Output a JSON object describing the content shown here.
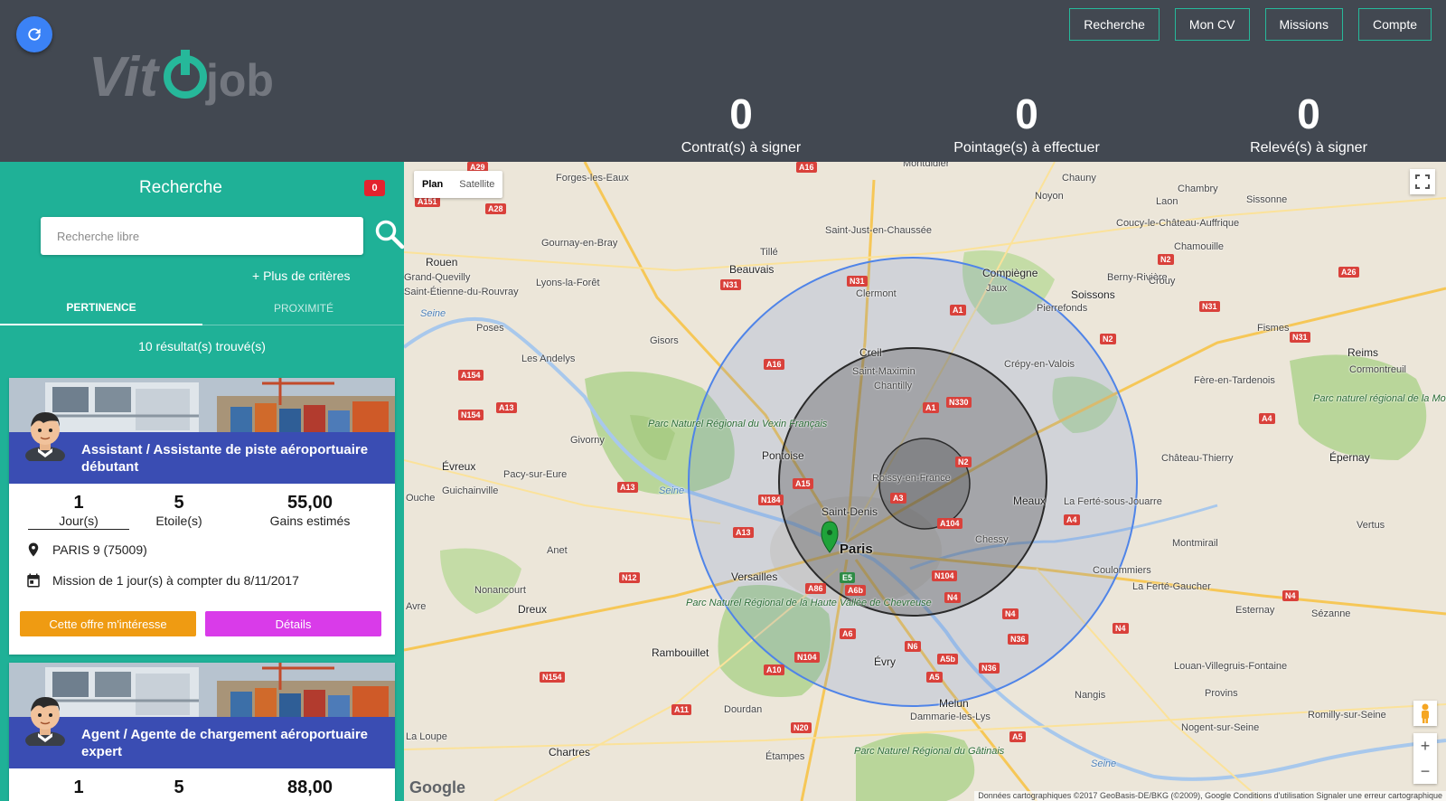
{
  "header": {
    "logo_text": "Vitojob",
    "nav": [
      "Recherche",
      "Mon CV",
      "Missions",
      "Compte"
    ],
    "stats": [
      {
        "value": "0",
        "label": "Contrat(s) à signer"
      },
      {
        "value": "0",
        "label": "Pointage(s) à effectuer"
      },
      {
        "value": "0",
        "label": "Relevé(s) à signer"
      }
    ]
  },
  "sidebar": {
    "title": "Recherche",
    "badge_count": "0",
    "search_placeholder": "Recherche libre",
    "more_criteria": "+ Plus de critères",
    "tabs": [
      "PERTINENCE",
      "PROXIMITÉ"
    ],
    "results_count": "10 résultat(s) trouvé(s)"
  },
  "jobs": [
    {
      "title": "Assistant / Assistante de piste aéroportuaire débutant",
      "days": "1",
      "days_label": "Jour(s)",
      "stars": "5",
      "stars_label": "Etoile(s)",
      "gains": "55,00",
      "gains_label": "Gains estimés",
      "location": "PARIS 9 (75009)",
      "mission": "Mission de 1 jour(s) à compter du 8/11/2017",
      "btn_interest": "Cette offre m'intéresse",
      "btn_details": "Détails"
    },
    {
      "title": "Agent / Agente de chargement aéroportuaire expert",
      "days": "1",
      "stars": "5",
      "gains": "88,00"
    }
  ],
  "map": {
    "type_options": [
      "Plan",
      "Satellite"
    ],
    "active_type": "Plan",
    "fullscreen_icon": "fullscreen-icon",
    "zoom_in": "+",
    "zoom_out": "−",
    "google_logo": "Google",
    "attribution": "Données cartographiques ©2017 GeoBasis-DE/BKG (©2009), Google    Conditions d'utilisation    Signaler une erreur cartographique",
    "cities": {
      "forges": "Forges-les-Eaux",
      "chauny": "Chauny",
      "laon": "Laon",
      "noyon": "Noyon",
      "chambry": "Chambry",
      "sissonne": "Sissonne",
      "montdidier": "Montdidier",
      "saint_just": "Saint-Just-en-Chaussée",
      "coucy": "Coucy-le-Château-Auffrique",
      "chamouille": "Chamouille",
      "gournay": "Gournay-en-Bray",
      "tille": "Tillé",
      "beauvais": "Beauvais",
      "rouen": "Rouen",
      "grand_quevilly": "Grand-Quevilly",
      "saint_etienne": "Saint-Étienne-du-Rouvray",
      "lyons": "Lyons-la-Forêt",
      "clermont": "Clermont",
      "compiegne": "Compiègne",
      "jaux": "Jaux",
      "berny": "Berny-Rivière",
      "soissons": "Soissons",
      "crouy": "Crouy",
      "pierrefonds": "Pierrefonds",
      "poses": "Poses",
      "gisors": "Gisors",
      "fismes": "Fismes",
      "reims": "Reims",
      "cormontreuil": "Cormontreuil",
      "les_andelys": "Les Andelys",
      "creil": "Creil",
      "saint_maximin": "Saint-Maximin",
      "chantilly": "Chantilly",
      "crepy": "Crépy-en-Valois",
      "fere": "Fère-en-Tardenois",
      "parc_reims": "Parc naturel régional de la Montagne de Reims",
      "givorny": "Givorny",
      "parc_vexin": "Parc Naturel Régional du Vexin Français",
      "pontoise": "Pontoise",
      "chateau_thierry": "Château-Thierry",
      "epernay": "Épernay",
      "evreux": "Évreux",
      "pacy": "Pacy-sur-Eure",
      "guichainville": "Guichainville",
      "roissy": "Roissy-en-France",
      "meaux": "Meaux",
      "la_ferte_jouarre": "La Ferté-sous-Jouarre",
      "ouche": "Ouche",
      "saint_denis": "Saint-Denis",
      "vertus": "Vertus",
      "anet": "Anet",
      "paris": "Paris",
      "chessy": "Chessy",
      "montmirail": "Montmirail",
      "versailles": "Versailles",
      "coulommiers": "Coulommiers",
      "nonancourt": "Nonancourt",
      "la_ferte_gaucher": "La Ferté-Gaucher",
      "dreux": "Dreux",
      "avre": "Avre",
      "parc_chevreuse": "Parc Naturel Régional de la Haute Vallée de Chevreuse",
      "esternay": "Esternay",
      "sezanne": "Sézanne",
      "rambouillet": "Rambouillet",
      "evry": "Évry",
      "louan": "Louan-Villegruis-Fontaine",
      "provins": "Provins",
      "nangis": "Nangis",
      "dourdan": "Dourdan",
      "melun": "Melun",
      "dammarie": "Dammarie-les-Lys",
      "romilly": "Romilly-sur-Seine",
      "la_loupe": "La Loupe",
      "chartres": "Chartres",
      "etampes": "Étampes",
      "nogent": "Nogent-sur-Seine",
      "parc_gatinais": "Parc Naturel Régional du Gâtinais",
      "seine": "Seine"
    },
    "roads": [
      "A29",
      "A16",
      "A151",
      "A28",
      "N31",
      "N31",
      "A1",
      "N2",
      "N2",
      "A26",
      "N31",
      "N31",
      "A16",
      "A154",
      "N154",
      "A13",
      "A1",
      "N330",
      "A4",
      "A13",
      "A15",
      "N184",
      "N2",
      "A3",
      "A104",
      "A4",
      "A13",
      "N12",
      "E5",
      "A86",
      "A6b",
      "N104",
      "N4",
      "N4",
      "N4",
      "N36",
      "A6",
      "N6",
      "A10",
      "N104",
      "A5b",
      "N36",
      "N154",
      "A11",
      "N20",
      "A5",
      "A5",
      "N4"
    ]
  }
}
